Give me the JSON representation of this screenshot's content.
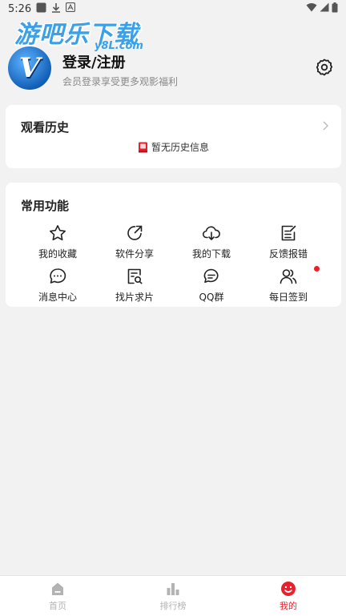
{
  "status_bar": {
    "time": "5:26"
  },
  "watermark": {
    "main": "游吧乐下载",
    "sub": "y8L.com"
  },
  "profile": {
    "avatar_letter": "V",
    "title": "登录/注册",
    "subtitle": "会员登录享受更多观影福利",
    "settings_icon": "gear-icon"
  },
  "history": {
    "title": "观看历史",
    "empty_text": "暂无历史信息"
  },
  "functions": {
    "title": "常用功能",
    "items": [
      {
        "label": "我的收藏",
        "icon": "star-icon"
      },
      {
        "label": "软件分享",
        "icon": "share-icon"
      },
      {
        "label": "我的下载",
        "icon": "cloud-download-icon"
      },
      {
        "label": "反馈报错",
        "icon": "edit-note-icon"
      },
      {
        "label": "消息中心",
        "icon": "message-icon"
      },
      {
        "label": "找片求片",
        "icon": "search-document-icon"
      },
      {
        "label": "QQ群",
        "icon": "chat-bubbles-icon"
      },
      {
        "label": "每日签到",
        "icon": "users-icon"
      }
    ]
  },
  "bottom_nav": {
    "items": [
      {
        "label": "首页",
        "icon": "home-icon"
      },
      {
        "label": "排行榜",
        "icon": "bar-chart-icon"
      },
      {
        "label": "我的",
        "icon": "smile-face-icon"
      }
    ],
    "active_index": 2
  },
  "colors": {
    "accent": "#e8202e",
    "watermark": "#3aa0e8",
    "inactive": "#b3b3b3"
  }
}
